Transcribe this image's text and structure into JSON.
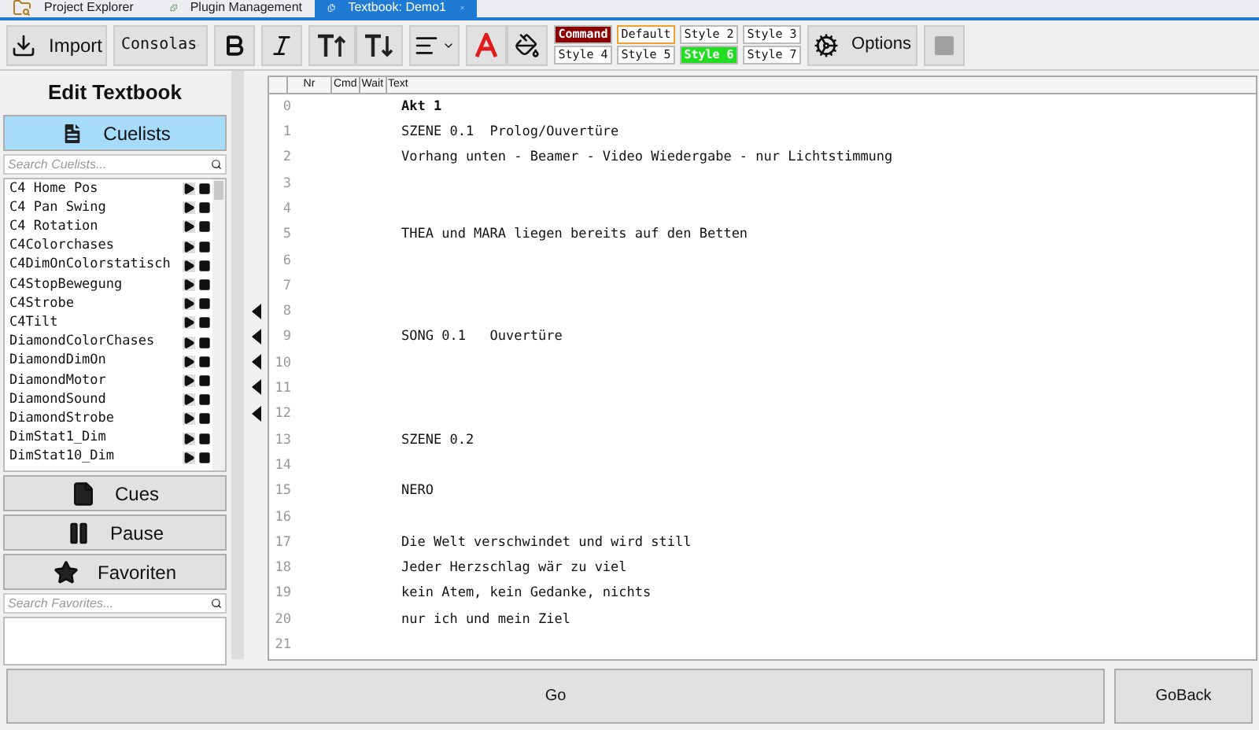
{
  "tabs": [
    {
      "label": "Project Explorer",
      "selected": false,
      "kind": "explorer"
    },
    {
      "label": "Plugin Management",
      "selected": false,
      "kind": "plugin"
    },
    {
      "label": "Textbook: Demo1",
      "selected": true,
      "kind": "textbook"
    }
  ],
  "toolbar": {
    "import": "Import",
    "font": "Consolas",
    "options": "Options"
  },
  "styles": [
    {
      "label": "Command",
      "color": "#8b0000",
      "selected": false
    },
    {
      "label": "Default",
      "color": "#ffffff",
      "selected": true
    },
    {
      "label": "Style 2",
      "color": "#ffffff",
      "selected": false
    },
    {
      "label": "Style 3",
      "color": "#ffffff",
      "selected": false
    },
    {
      "label": "Style 4",
      "color": "#ffffff",
      "selected": false
    },
    {
      "label": "Style 5",
      "color": "#ffffff",
      "selected": false
    },
    {
      "label": "Style 6",
      "color": "#22dd22",
      "selected": false
    },
    {
      "label": "Style 7",
      "color": "#ffffff",
      "selected": false
    }
  ],
  "sidebar": {
    "title": "Edit Textbook",
    "cuelists_button": {
      "label": "Cuelists",
      "selected": true
    },
    "cuelist_search": {
      "placeholder": "Search Cuelists..."
    },
    "cuelists": [
      "C4 Home Pos",
      "C4 Pan Swing",
      "C4 Rotation",
      "C4Colorchases",
      "C4DimOnColorstatisch",
      "C4StopBewegung",
      "C4Strobe",
      "C4Tilt",
      "DiamondColorChases",
      "DiamondDimOn",
      "DiamondMotor",
      "DiamondSound",
      "DiamondStrobe",
      "DimStat1_Dim",
      "DimStat10_Dim"
    ],
    "cues_button": {
      "label": "Cues",
      "selected": false
    },
    "pause_button": {
      "label": "Pause",
      "selected": false
    },
    "favorites_button": {
      "label": "Favoriten",
      "selected": false
    },
    "favorites_search": {
      "placeholder": "Search Favorites..."
    }
  },
  "editor": {
    "columns": [
      "Nr",
      "Cmd",
      "Wait",
      "Text"
    ],
    "lines": [
      {
        "nr": "0",
        "text": "Akt 1",
        "bold": true
      },
      {
        "nr": "1",
        "text": "SZENE 0.1  Prolog/Ouvertüre",
        "bold": false
      },
      {
        "nr": "2",
        "text": "Vorhang unten - Beamer - Video Wiedergabe - nur Lichtstimmung",
        "bold": false
      },
      {
        "nr": "3"
      },
      {
        "nr": "4"
      },
      {
        "nr": "5",
        "text": "THEA und MARA liegen bereits auf den Betten",
        "bold": false
      },
      {
        "nr": "6"
      },
      {
        "nr": "7"
      },
      {
        "nr": "8",
        "marked": true
      },
      {
        "nr": "9",
        "text": "SONG 0.1   Ouvertüre",
        "bold": false,
        "marked": true
      },
      {
        "nr": "10",
        "marked": true
      },
      {
        "nr": "11",
        "marked": true
      },
      {
        "nr": "12",
        "marked": true
      },
      {
        "nr": "13",
        "text": "SZENE 0.2",
        "bold": false
      },
      {
        "nr": "14"
      },
      {
        "nr": "15",
        "text": "NERO",
        "bold": false
      },
      {
        "nr": "16"
      },
      {
        "nr": "17",
        "text": "Die Welt verschwindet und wird still",
        "bold": false
      },
      {
        "nr": "18",
        "text": "Jeder Herzschlag wär zu viel",
        "bold": false
      },
      {
        "nr": "19",
        "text": "kein Atem, kein Gedanke, nichts",
        "bold": false
      },
      {
        "nr": "20",
        "text": "nur ich und mein Ziel",
        "bold": false
      },
      {
        "nr": "21"
      }
    ]
  },
  "actions": [
    "Go",
    "GoBack"
  ]
}
